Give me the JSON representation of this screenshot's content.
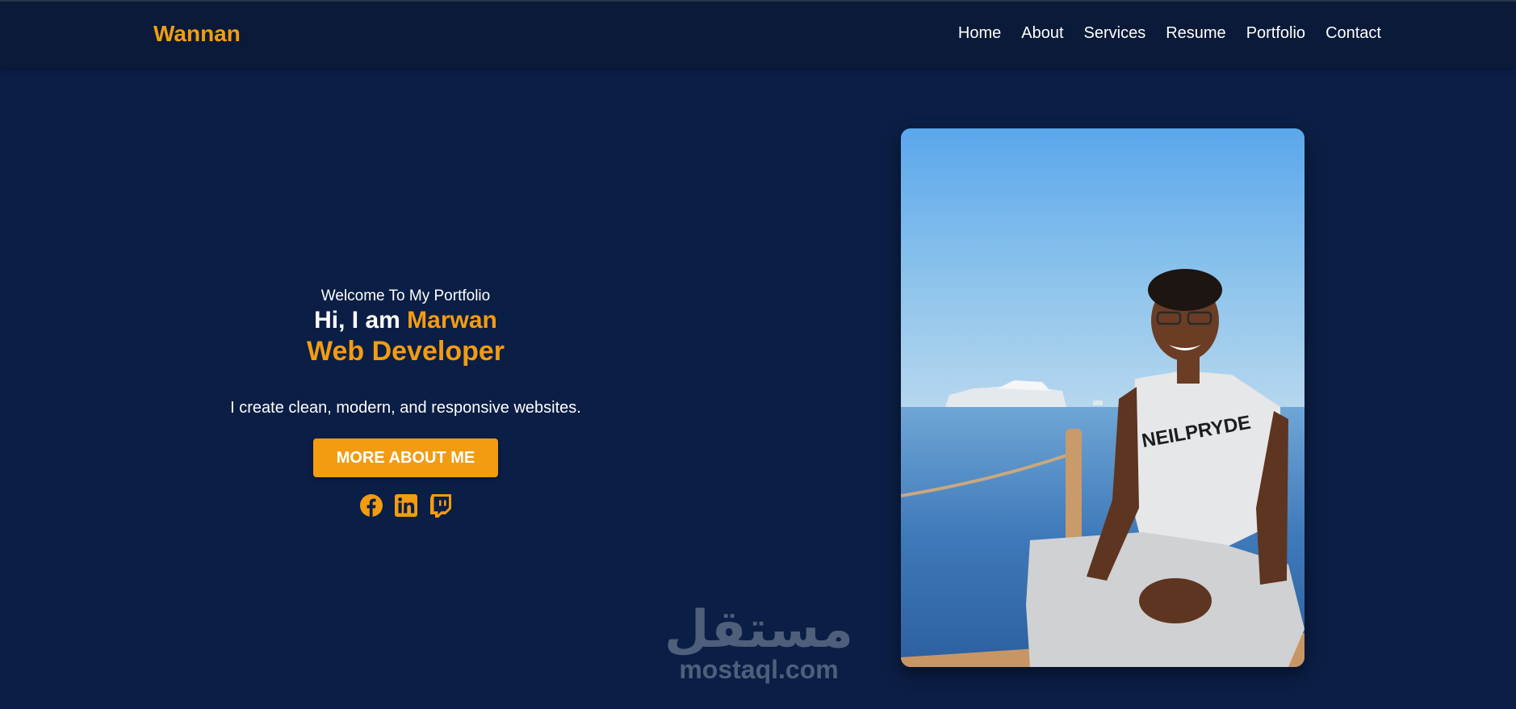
{
  "header": {
    "brand": "Wannan",
    "nav": [
      "Home",
      "About",
      "Services",
      "Resume",
      "Portfolio",
      "Contact"
    ]
  },
  "hero": {
    "welcome": "Welcome To My Portfolio",
    "greeting_prefix": "Hi, I am ",
    "name": "Marwan",
    "role": "Web Developer",
    "tagline": "I create clean, modern, and responsive websites.",
    "cta_label": "MORE ABOUT ME",
    "socials": [
      "facebook-icon",
      "linkedin-icon",
      "twitch-icon"
    ]
  },
  "watermark": {
    "arabic": "مستقل",
    "latin": "mostaql.com"
  },
  "colors": {
    "background": "#0b1e45",
    "header": "#0a1a38",
    "accent": "#f39c12",
    "text": "#ffffff"
  }
}
